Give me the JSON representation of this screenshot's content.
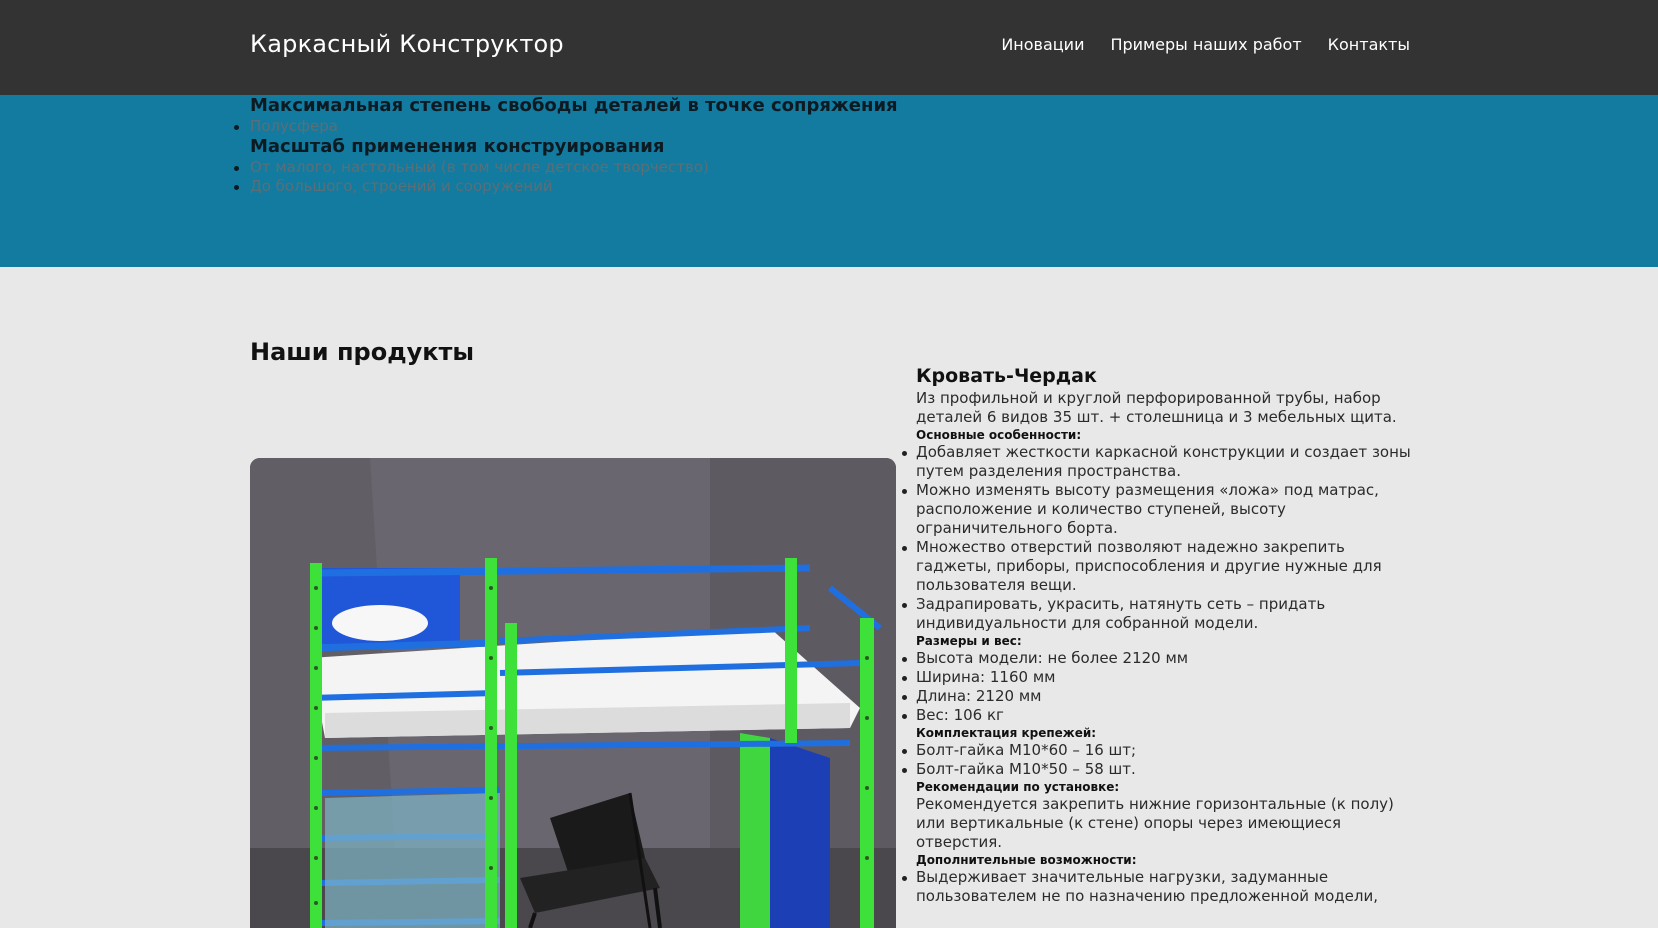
{
  "header": {
    "brand": "Каркасный Конструктор",
    "nav": [
      "Иновации",
      "Примеры наших работ",
      "Контакты"
    ]
  },
  "hero": {
    "heading1": "Максимальная степень свободы деталей в точке сопряжения",
    "list1": [
      "Полусфера"
    ],
    "heading2": "Масштаб применения конструирования",
    "list2": [
      "От малого, настольный (в том числе детское творчество)",
      "До большого, строений и сооружений"
    ]
  },
  "products": {
    "title": "Наши продукты",
    "item": {
      "name": "Кровать-Чердак",
      "description": "Из профильной и круглой перфорированной трубы, набор деталей 6 видов 35 шт. + столешница и 3 мебельных щита.",
      "features_label": "Основные особенности:",
      "features": [
        "Добавляет жесткости каркасной конструкции и создает зоны путем разделения пространства.",
        "Можно изменять высоту размещения «ложа» под матрас, расположение и количество ступеней, высоту ограничительного борта.",
        "Множество отверстий позволяют надежно закрепить гаджеты, приборы, приспособления и другие нужные для пользователя вещи.",
        "Задрапировать, украсить, натянуть сеть – придать индивидуальности для собранной модели."
      ],
      "size_label": "Размеры и вес:",
      "sizes": [
        "Высота модели: не более 2120 мм",
        "Ширина: 1160 мм",
        "Длина: 2120 мм",
        "Вес: 106 кг"
      ],
      "fasteners_label": "Комплектация крепежей:",
      "fasteners": [
        "Болт-гайка М10*60 – 16 шт;",
        "Болт-гайка М10*50 – 58 шт."
      ],
      "install_label": "Рекомендации по установке:",
      "install": "Рекомендуется закрепить нижние горизонтальные (к полу) или вертикальные (к стене) опоры через имеющиеся отверстия.",
      "extra_label": "Дополнительные возможности:",
      "extra": [
        "Выдерживает значительные нагрузки, задуманные пользователем не по назначению предложенной модели,"
      ]
    }
  },
  "colors": {
    "navbar": "#333333",
    "hero": "#127b9f",
    "page": "#e8e8e8"
  }
}
